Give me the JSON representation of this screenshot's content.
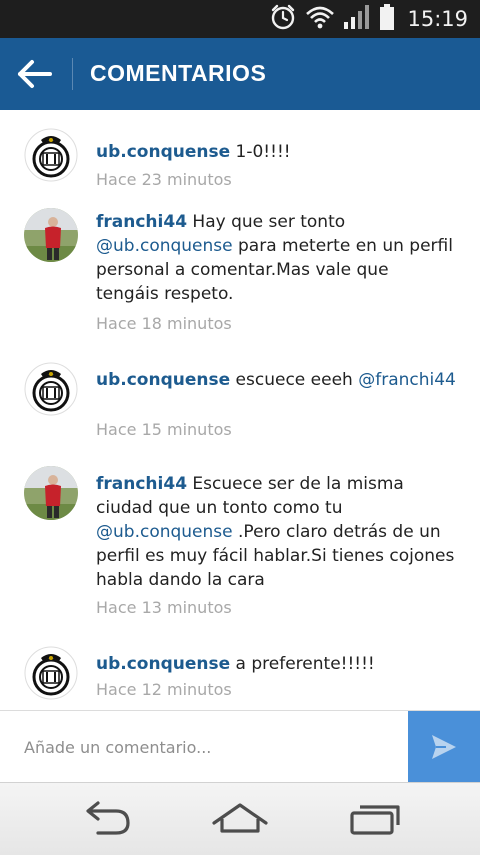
{
  "status_bar": {
    "time": "15:19"
  },
  "header": {
    "title": "COMENTARIOS"
  },
  "comments": [
    {
      "username": "ub.conquense",
      "parts": [
        " 1-0!!!!"
      ],
      "time": "Hace 23 minutos"
    },
    {
      "username": "franchi44",
      "parts": [
        " Hay que ser tonto ",
        "@ub.conquense",
        " para meterte en un perfil personal a comentar.Mas vale que tengáis respeto."
      ],
      "time": "Hace 18 minutos"
    },
    {
      "username": "ub.conquense",
      "parts": [
        " escuece eeeh ",
        "@franchi44"
      ],
      "time": "Hace 15 minutos"
    },
    {
      "username": "franchi44",
      "parts": [
        " Escuece ser de la misma ciudad que un tonto como tu ",
        "@ub.conquense",
        " .Pero claro detrás de un perfil es muy fácil hablar.Si tienes cojones habla dando la cara"
      ],
      "time": "Hace 13 minutos"
    },
    {
      "username": "ub.conquense",
      "parts": [
        " a preferente!!!!!"
      ],
      "time": "Hace 12 minutos"
    }
  ],
  "input": {
    "placeholder": "Añade un comentario..."
  },
  "colors": {
    "app_bar": "#1a5a94",
    "username": "#1d5b8f",
    "send_button": "#4a90d9",
    "status_bar": "#1e1e1e"
  },
  "icons": [
    "alarm-icon",
    "wifi-icon",
    "signal-icon",
    "battery-icon",
    "back-arrow-icon",
    "send-icon",
    "back-nav-icon",
    "home-nav-icon",
    "recents-nav-icon"
  ]
}
